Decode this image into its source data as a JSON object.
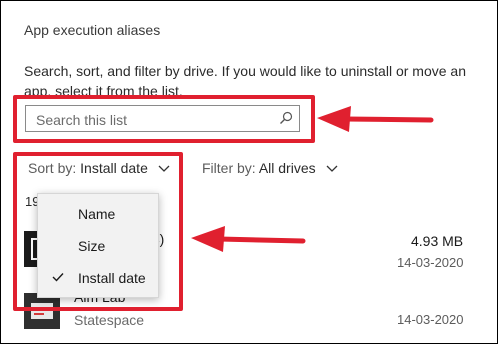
{
  "section": {
    "title": "App execution aliases",
    "description": "Search, sort, and filter by drive. If you would like to uninstall or move an app, select it from the list."
  },
  "search": {
    "placeholder": "Search this list",
    "value": ""
  },
  "sort": {
    "prefix": "Sort by:",
    "value": "Install date"
  },
  "filter": {
    "prefix": "Filter by:",
    "value": "All drives"
  },
  "apps_found_count_partial": "19",
  "dropdown": {
    "options": [
      "Name",
      "Size",
      "Install date"
    ],
    "selected": "Install date"
  },
  "apps": [
    {
      "name_visible_tail": "64)",
      "size": "4.93 MB",
      "date": "14-03-2020"
    },
    {
      "name": "Aim Lab",
      "publisher": "Statespace",
      "date": "14-03-2020"
    }
  ],
  "colors": {
    "highlight_red": "#e0202f",
    "dropdown_bg": "#f2f2f2"
  }
}
